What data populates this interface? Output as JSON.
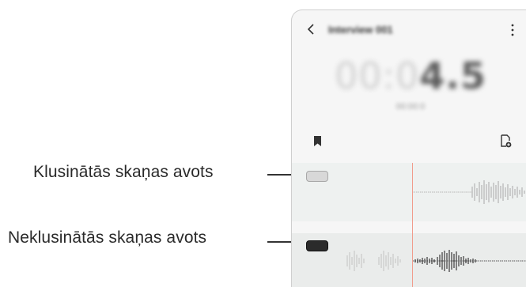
{
  "callouts": {
    "muted": "Klusinātās skaņas avots",
    "unmuted": "Neklusinātās skaņas avots"
  },
  "app": {
    "title": "Interview 001",
    "timer_dim": "00:0",
    "timer_strong": "4.5",
    "subtime": "00:00:0"
  },
  "icons": {
    "back": "chevron-left-icon",
    "more": "more-vertical-icon",
    "bookmark": "bookmark-icon",
    "add_file": "file-add-icon"
  },
  "tracks": [
    {
      "name": "muted-source",
      "muted": true,
      "toggle_color": "#d8d8d8"
    },
    {
      "name": "unmuted-source",
      "muted": false,
      "toggle_color": "#2b2b2b"
    }
  ],
  "colors": {
    "playhead": "#f19c8c",
    "waveform_active": "#3a3a3a",
    "waveform_dim": "#a0a0a0"
  }
}
